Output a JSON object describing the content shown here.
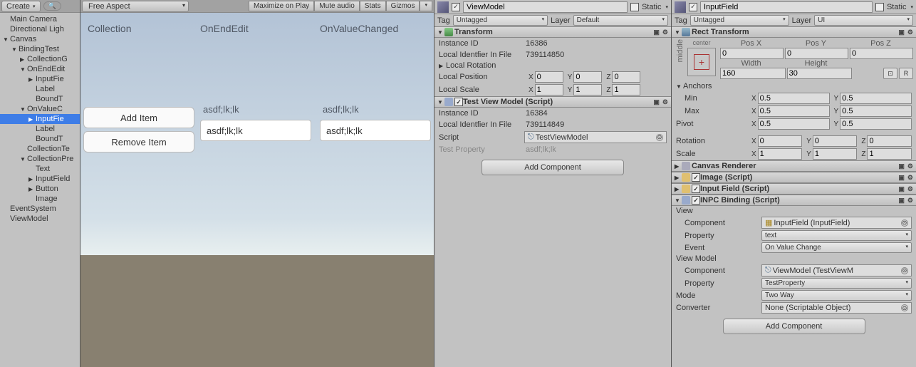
{
  "hierarchy": {
    "create_label": "Create",
    "items": [
      {
        "depth": 0,
        "arrow": "",
        "label": "Main Camera"
      },
      {
        "depth": 0,
        "arrow": "",
        "label": "Directional Ligh"
      },
      {
        "depth": 0,
        "arrow": "▼",
        "label": "Canvas"
      },
      {
        "depth": 1,
        "arrow": "▼",
        "label": "BindingTest"
      },
      {
        "depth": 2,
        "arrow": "▶",
        "label": "CollectionG"
      },
      {
        "depth": 2,
        "arrow": "▼",
        "label": "OnEndEdit"
      },
      {
        "depth": 3,
        "arrow": "▶",
        "label": "InputFie"
      },
      {
        "depth": 3,
        "arrow": "",
        "label": "Label"
      },
      {
        "depth": 3,
        "arrow": "",
        "label": "BoundT"
      },
      {
        "depth": 2,
        "arrow": "▼",
        "label": "OnValueC"
      },
      {
        "depth": 3,
        "arrow": "▶",
        "label": "InputFie",
        "selected": true
      },
      {
        "depth": 3,
        "arrow": "",
        "label": "Label"
      },
      {
        "depth": 3,
        "arrow": "",
        "label": "BoundT"
      },
      {
        "depth": 2,
        "arrow": "",
        "label": "CollectionTe"
      },
      {
        "depth": 2,
        "arrow": "▼",
        "label": "CollectionPre"
      },
      {
        "depth": 3,
        "arrow": "",
        "label": "Text"
      },
      {
        "depth": 3,
        "arrow": "▶",
        "label": "InputField"
      },
      {
        "depth": 3,
        "arrow": "▶",
        "label": "Button"
      },
      {
        "depth": 3,
        "arrow": "",
        "label": "Image"
      },
      {
        "depth": 0,
        "arrow": "",
        "label": "EventSystem"
      },
      {
        "depth": 0,
        "arrow": "",
        "label": "ViewModel"
      }
    ]
  },
  "game": {
    "aspect": "Free Aspect",
    "toolbar": [
      "Maximize on Play",
      "Mute audio",
      "Stats",
      "Gizmos"
    ],
    "labels": {
      "col": "Collection",
      "onend": "OnEndEdit",
      "onval": "OnValueChanged"
    },
    "bound1": "asdf;lk;lk",
    "bound2": "asdf;lk;lk",
    "input1": "asdf;lk;lk",
    "input2": "asdf;lk;lk",
    "btn_add": "Add Item",
    "btn_remove": "Remove Item"
  },
  "insp1": {
    "name": "ViewModel",
    "static_label": "Static",
    "tag_label": "Tag",
    "tag_val": "Untagged",
    "layer_label": "Layer",
    "layer_val": "Default",
    "transform": {
      "title": "Transform",
      "instance_id_label": "Instance ID",
      "instance_id": "16386",
      "local_id_label": "Local Identfier In File",
      "local_id": "739114850",
      "local_rot_label": "Local Rotation",
      "local_pos_label": "Local Position",
      "pos": [
        "0",
        "0",
        "0"
      ],
      "local_scale_label": "Local Scale",
      "scale": [
        "1",
        "1",
        "1"
      ]
    },
    "tvm": {
      "title": "Test View Model (Script)",
      "instance_id_label": "Instance ID",
      "instance_id": "16384",
      "local_id_label": "Local Identfier In File",
      "local_id": "739114849",
      "script_label": "Script",
      "script_val": "TestViewModel",
      "testprop_label": "Test Property",
      "testprop_val": "asdf;lk;lk"
    },
    "add_component": "Add Component"
  },
  "insp2": {
    "name": "InputField",
    "static_label": "Static",
    "tag_label": "Tag",
    "tag_val": "Untagged",
    "layer_label": "Layer",
    "layer_val": "UI",
    "rect": {
      "title": "Rect Transform",
      "center_label": "center",
      "middle_label": "middle",
      "posx_label": "Pos X",
      "posy_label": "Pos Y",
      "posz_label": "Pos Z",
      "posx": "0",
      "posy": "0",
      "posz": "0",
      "width_label": "Width",
      "height_label": "Height",
      "width": "160",
      "height": "30",
      "anchors_label": "Anchors",
      "min_label": "Min",
      "min": [
        "0.5",
        "0.5"
      ],
      "max_label": "Max",
      "max": [
        "0.5",
        "0.5"
      ],
      "pivot_label": "Pivot",
      "pivot": [
        "0.5",
        "0.5"
      ],
      "rotation_label": "Rotation",
      "rotation": [
        "0",
        "0",
        "0"
      ],
      "scale_label": "Scale",
      "scale": [
        "1",
        "1",
        "1"
      ]
    },
    "comps": [
      {
        "title": "Canvas Renderer",
        "folded": true,
        "checkbox": false
      },
      {
        "title": "Image (Script)",
        "folded": true,
        "checkbox": true,
        "icon": "#e0c070"
      },
      {
        "title": "Input Field (Script)",
        "folded": true,
        "checkbox": true,
        "icon": "#e0c070"
      }
    ],
    "inpc": {
      "title": "INPC Binding (Script)",
      "view_label": "View",
      "comp_label": "Component",
      "comp_val": "InputField (InputField)",
      "prop_label": "Property",
      "prop_val": "text",
      "event_label": "Event",
      "event_val": "On Value Change",
      "vm_label": "View Model",
      "vm_comp_label": "Component",
      "vm_comp_val": "ViewModel (TestViewM",
      "vm_prop_label": "Property",
      "vm_prop_val": "TestProperty",
      "mode_label": "Mode",
      "mode_val": "Two Way",
      "conv_label": "Converter",
      "conv_val": "None (Scriptable Object)"
    },
    "add_component": "Add Component"
  }
}
